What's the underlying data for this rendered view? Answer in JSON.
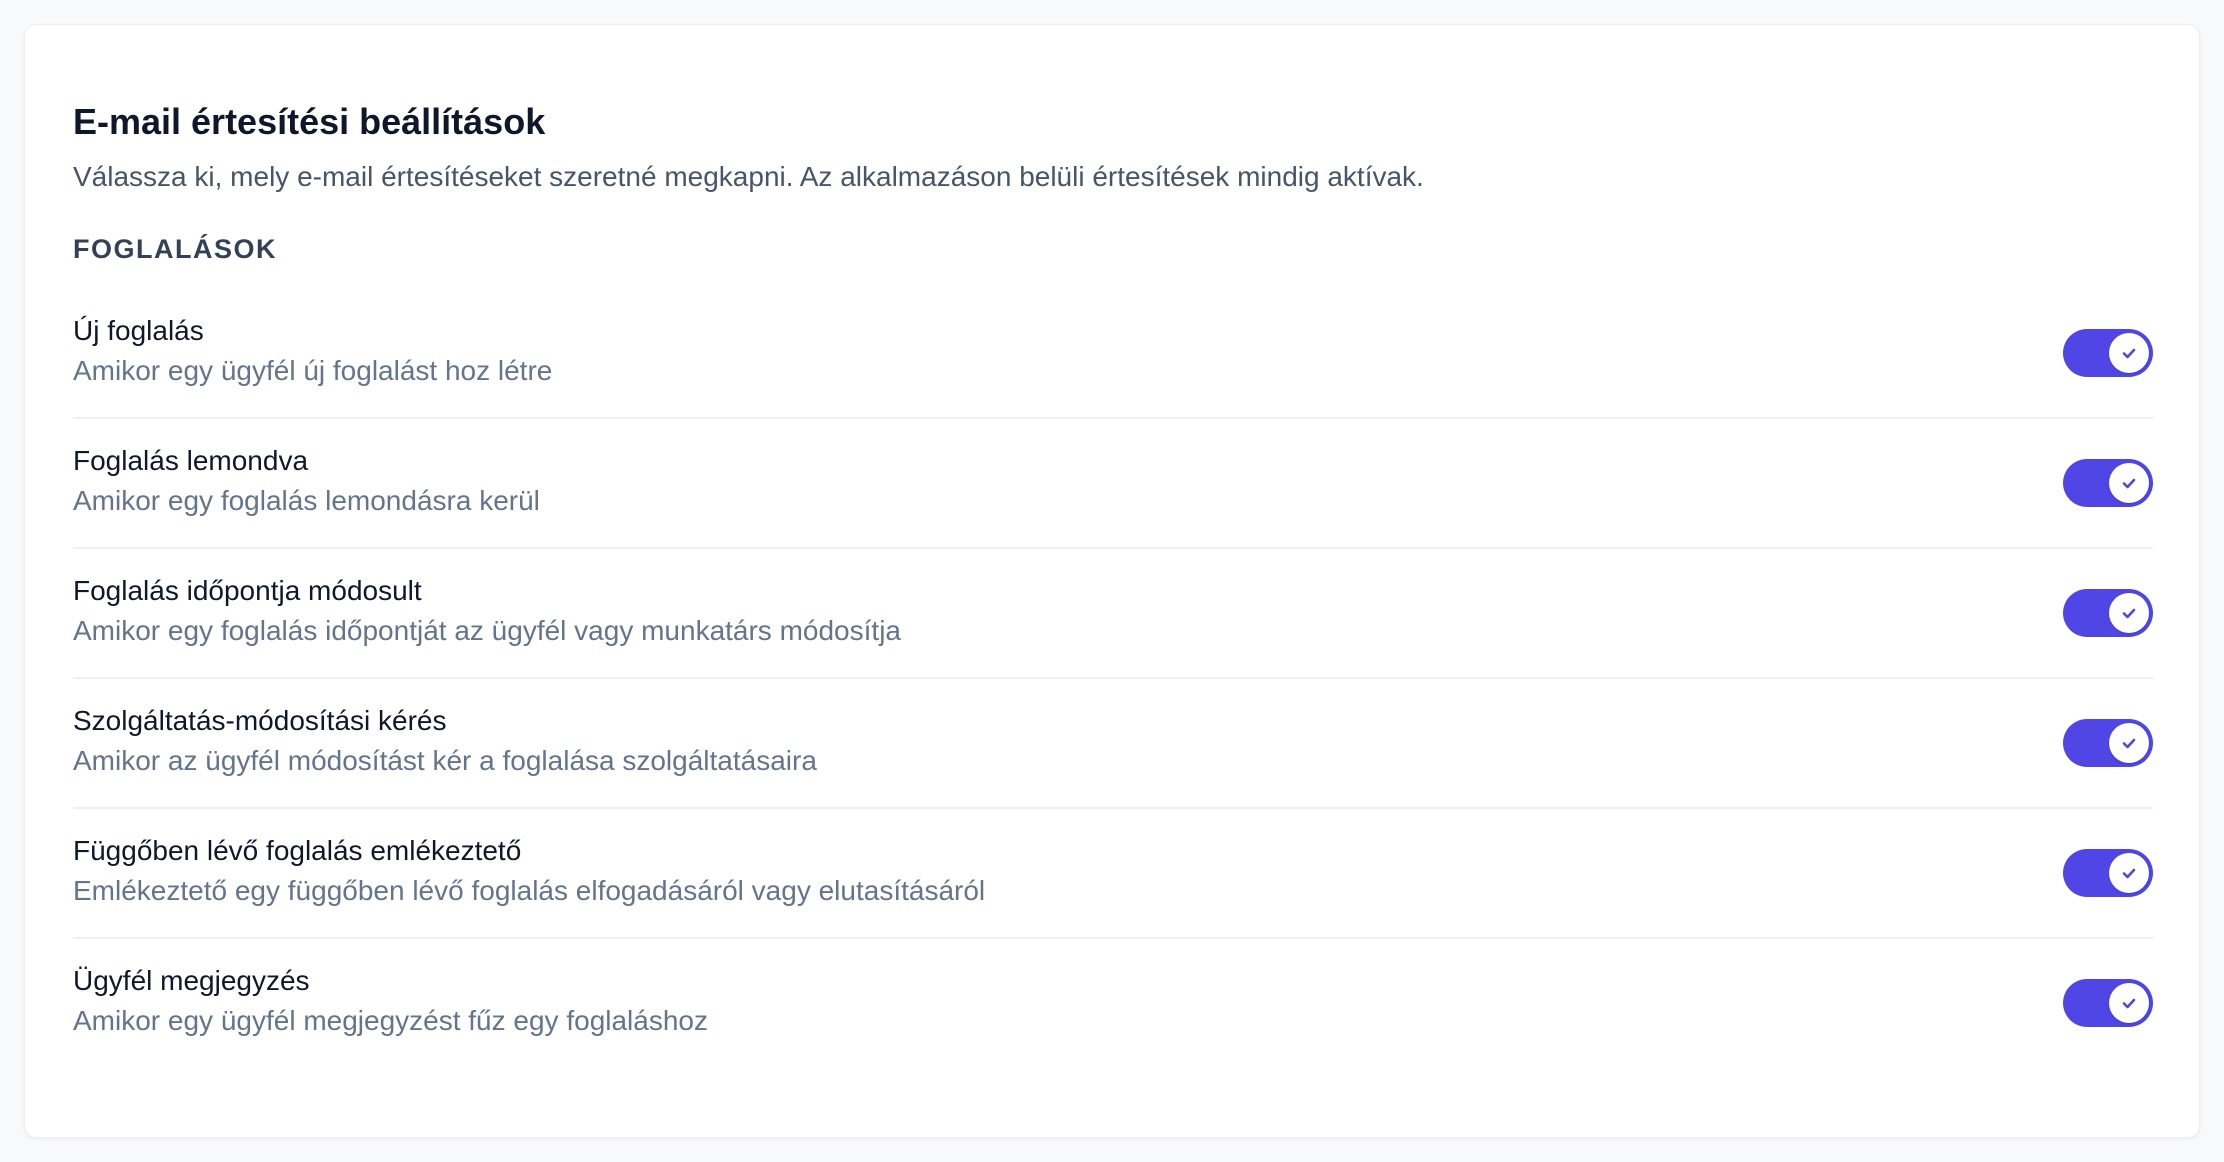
{
  "header": {
    "title": "E-mail értesítési beállítások",
    "subtitle": "Válassza ki, mely e-mail értesítéseket szeretné megkapni. Az alkalmazáson belüli értesítések mindig aktívak."
  },
  "section": {
    "heading": "FOGLALÁSOK"
  },
  "settings": [
    {
      "title": "Új foglalás",
      "description": "Amikor egy ügyfél új foglalást hoz létre",
      "enabled": true
    },
    {
      "title": "Foglalás lemondva",
      "description": "Amikor egy foglalás lemondásra kerül",
      "enabled": true
    },
    {
      "title": "Foglalás időpontja módosult",
      "description": "Amikor egy foglalás időpontját az ügyfél vagy munkatárs módosítja",
      "enabled": true
    },
    {
      "title": "Szolgáltatás-módosítási kérés",
      "description": "Amikor az ügyfél módosítást kér a foglalása szolgáltatásaira",
      "enabled": true
    },
    {
      "title": "Függőben lévő foglalás emlékeztető",
      "description": "Emlékeztető egy függőben lévő foglalás elfogadásáról vagy elutasításáról",
      "enabled": true
    },
    {
      "title": "Ügyfél megjegyzés",
      "description": "Amikor egy ügyfél megjegyzést fűz egy foglaláshoz",
      "enabled": true
    }
  ],
  "toggle_icon": "check-icon",
  "colors": {
    "accent": "#4f46e5",
    "text_primary": "#0f172a",
    "text_secondary": "#64748b"
  }
}
